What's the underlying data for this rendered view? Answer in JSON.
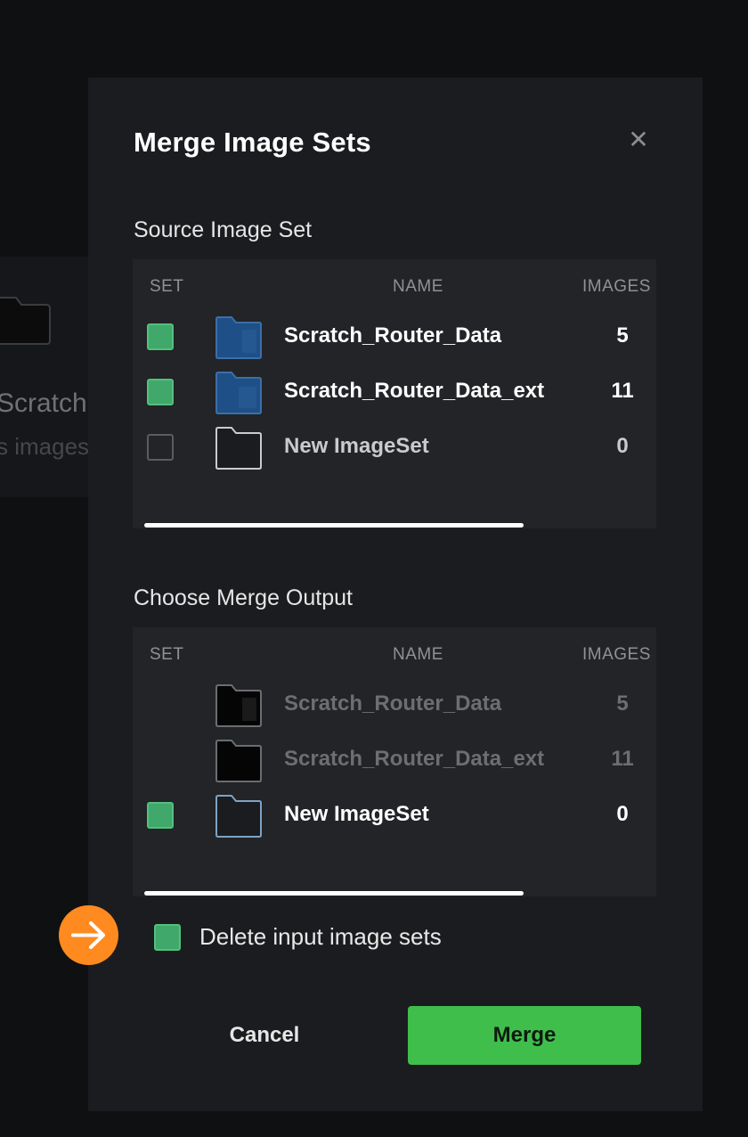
{
  "background": {
    "item_name": "Scratch",
    "item_sub": "s images"
  },
  "modal": {
    "title": "Merge Image Sets",
    "close_icon": "close-icon",
    "source": {
      "label": "Source Image Set",
      "columns": {
        "set": "SET",
        "name": "NAME",
        "images": "IMAGES"
      },
      "rows": [
        {
          "name": "Scratch_Router_Data",
          "images": "5",
          "checked": true,
          "folder": "filled-folder-icon"
        },
        {
          "name": "Scratch_Router_Data_ext",
          "images": "11",
          "checked": true,
          "folder": "filled-folder-icon"
        },
        {
          "name": "New ImageSet",
          "images": "0",
          "checked": false,
          "folder": "empty-folder-icon"
        }
      ]
    },
    "output": {
      "label": "Choose Merge Output",
      "columns": {
        "set": "SET",
        "name": "NAME",
        "images": "IMAGES"
      },
      "rows": [
        {
          "name": "Scratch_Router_Data",
          "images": "5",
          "checked": false,
          "disabled": true
        },
        {
          "name": "Scratch_Router_Data_ext",
          "images": "11",
          "checked": false,
          "disabled": true
        },
        {
          "name": "New ImageSet",
          "images": "0",
          "checked": true,
          "disabled": false
        }
      ]
    },
    "delete_input": {
      "label": "Delete input image sets",
      "checked": true
    },
    "buttons": {
      "cancel": "Cancel",
      "merge": "Merge"
    }
  },
  "colors": {
    "accent_green": "#3fbe4c",
    "checkbox_green": "#3fa86a",
    "annotation_orange": "#ff8a1f",
    "folder_blue": "#1e4f86"
  }
}
